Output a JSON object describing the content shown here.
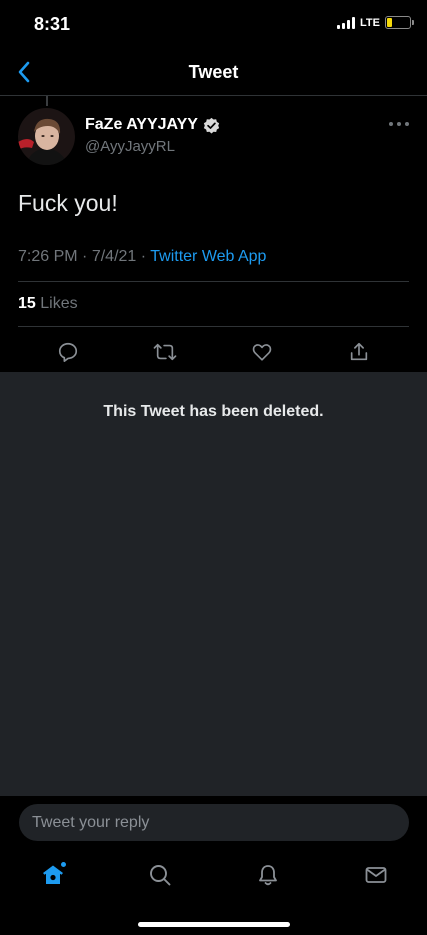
{
  "status_bar": {
    "time": "8:31",
    "network": "LTE",
    "battery_level": 0.22,
    "battery_color": "#f5d90a"
  },
  "header": {
    "title": "Tweet",
    "back_icon": "chevron-left-icon"
  },
  "tweet": {
    "author": {
      "name": "FaZe AYYJAYY",
      "handle": "@AyyJayyRL",
      "verified": true
    },
    "text": "Fuck you!",
    "time": "7:26 PM",
    "date": "7/4/21",
    "separator": "·",
    "source": "Twitter Web App",
    "likes_count": "15",
    "likes_label": "Likes"
  },
  "actions": [
    "reply-icon",
    "retweet-icon",
    "like-icon",
    "share-icon"
  ],
  "deleted_notice": "This Tweet has been deleted.",
  "reply": {
    "placeholder": "Tweet your reply"
  },
  "tabs": [
    "home-icon",
    "search-icon",
    "notifications-icon",
    "messages-icon"
  ],
  "colors": {
    "accent": "#1d9bf0",
    "background": "#000000",
    "panel": "#202327",
    "muted_text": "#71767b"
  }
}
